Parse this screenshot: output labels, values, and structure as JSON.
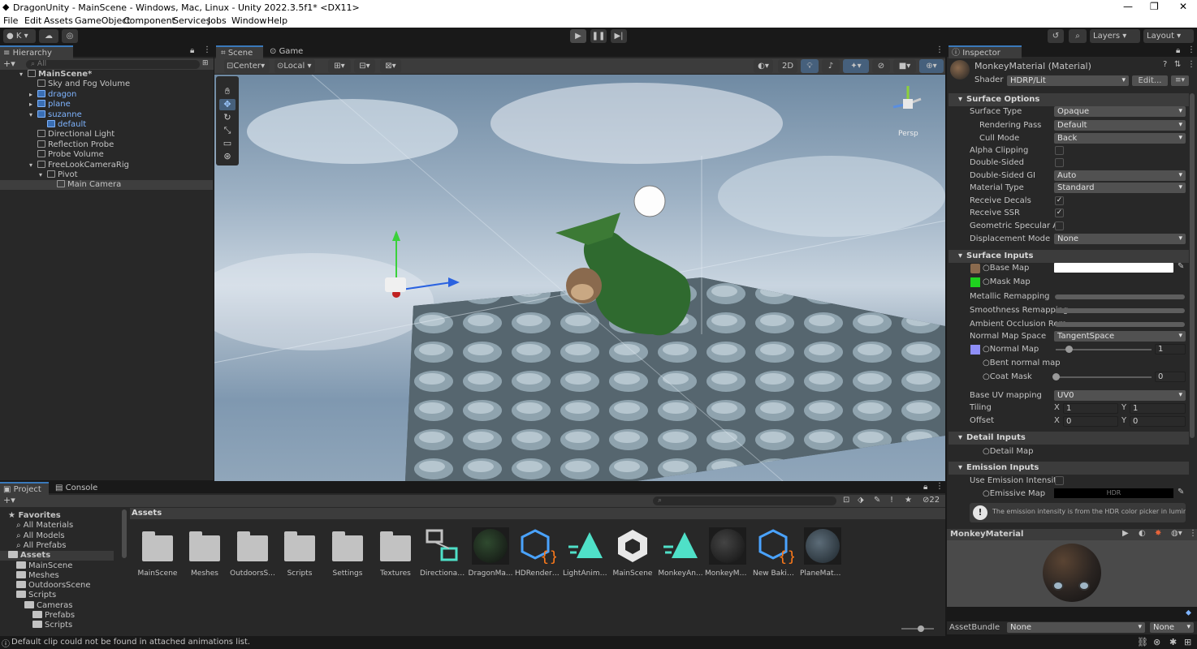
{
  "window": {
    "title": "DragonUnity - MainScene - Windows, Mac, Linux - Unity 2022.3.5f1* <DX11>"
  },
  "menu": [
    "File",
    "Edit",
    "Assets",
    "GameObject",
    "Component",
    "Services",
    "Jobs",
    "Window",
    "Help"
  ],
  "toolbar": {
    "account": "K",
    "layers": "Layers",
    "layout": "Layout"
  },
  "hierarchy": {
    "tab": "Hierarchy",
    "search_placeholder": "All",
    "items": [
      {
        "label": "MainScene*",
        "indent": 0,
        "arrow": "▾",
        "blue": false,
        "bold": true
      },
      {
        "label": "Sky and Fog Volume",
        "indent": 1,
        "arrow": "",
        "blue": false
      },
      {
        "label": "dragon",
        "indent": 1,
        "arrow": "▸",
        "blue": true
      },
      {
        "label": "plane",
        "indent": 1,
        "arrow": "▸",
        "blue": true
      },
      {
        "label": "suzanne",
        "indent": 1,
        "arrow": "▾",
        "blue": true
      },
      {
        "label": "default",
        "indent": 2,
        "arrow": "",
        "blue": true
      },
      {
        "label": "Directional Light",
        "indent": 1,
        "arrow": "",
        "blue": false
      },
      {
        "label": "Reflection Probe",
        "indent": 1,
        "arrow": "",
        "blue": false
      },
      {
        "label": "Probe Volume",
        "indent": 1,
        "arrow": "",
        "blue": false
      },
      {
        "label": "FreeLookCameraRig",
        "indent": 1,
        "arrow": "▾",
        "blue": false
      },
      {
        "label": "Pivot",
        "indent": 2,
        "arrow": "▾",
        "blue": false
      },
      {
        "label": "Main Camera",
        "indent": 3,
        "arrow": "",
        "blue": false,
        "selected": true
      }
    ]
  },
  "scene": {
    "tab_scene": "Scene",
    "tab_game": "Game",
    "pivot": "Center",
    "space": "Local",
    "mode2d": "2D",
    "persp": "Persp"
  },
  "inspector": {
    "tab": "Inspector",
    "material": "MonkeyMaterial (Material)",
    "shader_label": "Shader",
    "shader": "HDRP/Lit",
    "edit": "Edit...",
    "surface_options": "Surface Options",
    "surface_type_label": "Surface Type",
    "surface_type": "Opaque",
    "rendering_pass_label": "Rendering Pass",
    "rendering_pass": "Default",
    "cull_mode_label": "Cull Mode",
    "cull_mode": "Back",
    "alpha_clipping": "Alpha Clipping",
    "double_sided": "Double-Sided",
    "double_sided_gi_label": "Double-Sided GI",
    "double_sided_gi": "Auto",
    "material_type_label": "Material Type",
    "material_type": "Standard",
    "receive_decals": "Receive Decals",
    "receive_ssr": "Receive SSR",
    "geometric_specular_aa": "Geometric Specular AA",
    "displacement_mode_label": "Displacement Mode",
    "displacement_mode": "None",
    "surface_inputs": "Surface Inputs",
    "base_map": "Base Map",
    "mask_map": "Mask Map",
    "metallic_remapping": "Metallic Remapping",
    "smoothness_remapping": "Smoothness Remapping",
    "ao_remapping": "Ambient Occlusion Rem",
    "normal_map_space_label": "Normal Map Space",
    "normal_map_space": "TangentSpace",
    "normal_map": "Normal Map",
    "normal_value": "1",
    "bent_normal_map": "Bent normal map",
    "coat_mask": "Coat Mask",
    "coat_value": "0",
    "base_uv_label": "Base UV mapping",
    "base_uv": "UV0",
    "tiling": "Tiling",
    "offset": "Offset",
    "x": "X",
    "y": "Y",
    "tiling_x": "1",
    "tiling_y": "1",
    "offset_x": "0",
    "offset_y": "0",
    "detail_inputs": "Detail Inputs",
    "detail_map": "Detail Map",
    "emission_inputs": "Emission Inputs",
    "use_emission": "Use Emission Intensity",
    "emissive_map": "Emissive Map",
    "hdr": "HDR",
    "emission_note": "The emission intensity is from the HDR color picker in luminance",
    "preview_title": "MonkeyMaterial",
    "assetbundle_label": "AssetBundle",
    "assetbundle": "None",
    "variant": "None"
  },
  "project": {
    "tab_project": "Project",
    "tab_console": "Console",
    "hidden_count": "22",
    "breadcrumb": "Assets",
    "tree": [
      {
        "label": "Favorites",
        "indent": 0,
        "kind": "star",
        "bold": true
      },
      {
        "label": "All Materials",
        "indent": 1,
        "kind": "search"
      },
      {
        "label": "All Models",
        "indent": 1,
        "kind": "search"
      },
      {
        "label": "All Prefabs",
        "indent": 1,
        "kind": "search"
      },
      {
        "label": "Assets",
        "indent": 0,
        "kind": "folder",
        "bold": true
      },
      {
        "label": "MainScene",
        "indent": 1,
        "kind": "folder"
      },
      {
        "label": "Meshes",
        "indent": 1,
        "kind": "folder"
      },
      {
        "label": "OutdoorsScene",
        "indent": 1,
        "kind": "folder"
      },
      {
        "label": "Scripts",
        "indent": 1,
        "kind": "folder"
      },
      {
        "label": "Cameras",
        "indent": 2,
        "kind": "folder"
      },
      {
        "label": "Prefabs",
        "indent": 3,
        "kind": "folder"
      },
      {
        "label": "Scripts",
        "indent": 3,
        "kind": "folder"
      }
    ],
    "assets": [
      {
        "label": "MainScene",
        "kind": "folder"
      },
      {
        "label": "Meshes",
        "kind": "folder"
      },
      {
        "label": "OutdoorsS...",
        "kind": "folder"
      },
      {
        "label": "Scripts",
        "kind": "folder"
      },
      {
        "label": "Settings",
        "kind": "folder"
      },
      {
        "label": "Textures",
        "kind": "folder"
      },
      {
        "label": "Directional...",
        "kind": "lightnodes"
      },
      {
        "label": "DragonMa...",
        "kind": "sphere-dark"
      },
      {
        "label": "HDRenderP...",
        "kind": "cube-script"
      },
      {
        "label": "LightAnima...",
        "kind": "anim"
      },
      {
        "label": "MainScene",
        "kind": "unity"
      },
      {
        "label": "MonkeyAn...",
        "kind": "anim"
      },
      {
        "label": "MonkeyMa...",
        "kind": "sphere-monkey"
      },
      {
        "label": "New Bakin...",
        "kind": "cube-script"
      },
      {
        "label": "PlaneMater...",
        "kind": "sphere-blue"
      }
    ]
  },
  "status": {
    "message": "Default clip could not be found in attached animations list."
  }
}
